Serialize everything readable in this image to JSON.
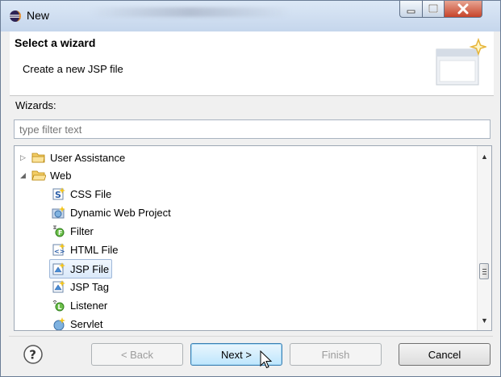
{
  "window": {
    "title": "New",
    "icon": "eclipse-icon"
  },
  "header": {
    "title": "Select a wizard",
    "description": "Create a new JSP file",
    "icon": "new-wizard-banner-icon"
  },
  "wizards_label": "Wizards:",
  "filter": {
    "placeholder": "type filter text",
    "value": ""
  },
  "tree": {
    "items": [
      {
        "label": "User Assistance",
        "icon": "folder-icon",
        "expanded": false,
        "level": 0
      },
      {
        "label": "Web",
        "icon": "folder-icon",
        "expanded": true,
        "level": 0
      },
      {
        "label": "CSS File",
        "icon": "css-file-icon",
        "level": 1
      },
      {
        "label": "Dynamic Web Project",
        "icon": "web-project-icon",
        "level": 1
      },
      {
        "label": "Filter",
        "icon": "filter-icon",
        "level": 1
      },
      {
        "label": "HTML File",
        "icon": "html-file-icon",
        "level": 1
      },
      {
        "label": "JSP File",
        "icon": "jsp-file-icon",
        "level": 1,
        "selected": true
      },
      {
        "label": "JSP Tag",
        "icon": "jsp-tag-icon",
        "level": 1
      },
      {
        "label": "Listener",
        "icon": "listener-icon",
        "level": 1
      },
      {
        "label": "Servlet",
        "icon": "servlet-icon",
        "level": 1
      }
    ]
  },
  "buttons": {
    "back": "< Back",
    "next": "Next >",
    "finish": "Finish",
    "cancel": "Cancel"
  },
  "colors": {
    "title_bar": "#c5d6ec",
    "close_button": "#c7442a",
    "selection": "#dbe9fa",
    "default_button": "#bee6fd",
    "folder": "#e8b84a"
  }
}
